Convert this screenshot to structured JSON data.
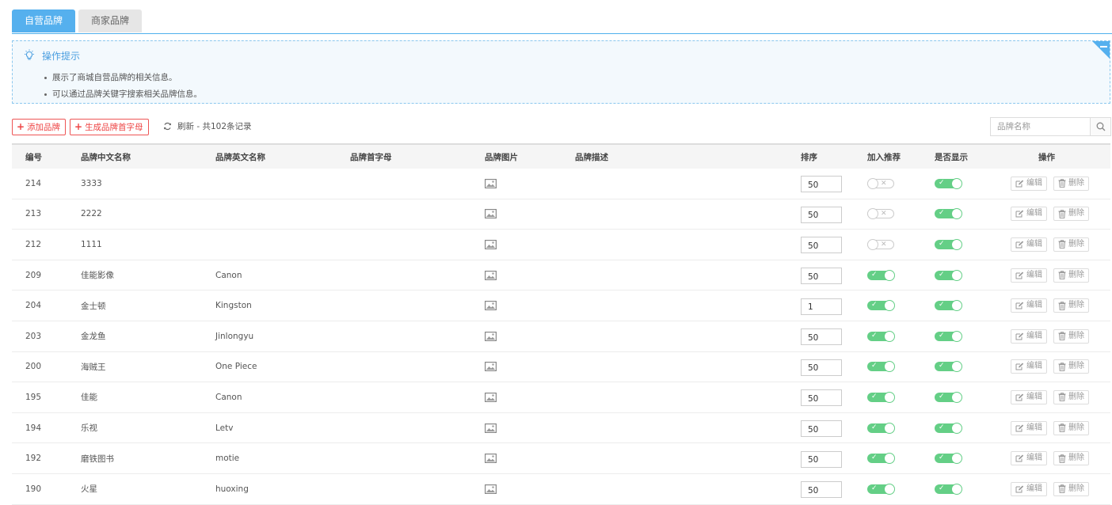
{
  "tabs": [
    {
      "label": "自营品牌",
      "active": true
    },
    {
      "label": "商家品牌",
      "active": false
    }
  ],
  "tips": {
    "title": "操作提示",
    "items": [
      "展示了商城自营品牌的相关信息。",
      "可以通过品牌关键字搜索相关品牌信息。"
    ]
  },
  "toolbar": {
    "add_label": "添加品牌",
    "generate_label": "生成品牌首字母",
    "refresh_label": "刷新 - 共102条记录",
    "search_placeholder": "品牌名称"
  },
  "table": {
    "headers": {
      "id": "编号",
      "cn_name": "品牌中文名称",
      "en_name": "品牌英文名称",
      "letter": "品牌首字母",
      "image": "品牌图片",
      "desc": "品牌描述",
      "sort": "排序",
      "recommend": "加入推荐",
      "show": "是否显示",
      "ops": "操作"
    },
    "edit_label": "编辑",
    "delete_label": "删除",
    "rows": [
      {
        "id": "214",
        "cn": "3333",
        "en": "",
        "sort": "50",
        "recommend": false,
        "show": true
      },
      {
        "id": "213",
        "cn": "2222",
        "en": "",
        "sort": "50",
        "recommend": false,
        "show": true
      },
      {
        "id": "212",
        "cn": "1111",
        "en": "",
        "sort": "50",
        "recommend": false,
        "show": true
      },
      {
        "id": "209",
        "cn": "佳能影像",
        "en": "Canon",
        "sort": "50",
        "recommend": true,
        "show": true
      },
      {
        "id": "204",
        "cn": "金士顿",
        "en": "Kingston",
        "sort": "1",
        "recommend": true,
        "show": true
      },
      {
        "id": "203",
        "cn": "金龙鱼",
        "en": "Jinlongyu",
        "sort": "50",
        "recommend": true,
        "show": true
      },
      {
        "id": "200",
        "cn": "海贼王",
        "en": "One Piece",
        "sort": "50",
        "recommend": true,
        "show": true
      },
      {
        "id": "195",
        "cn": "佳能",
        "en": "Canon",
        "sort": "50",
        "recommend": true,
        "show": true
      },
      {
        "id": "194",
        "cn": "乐视",
        "en": "Letv",
        "sort": "50",
        "recommend": true,
        "show": true
      },
      {
        "id": "192",
        "cn": "磨铁图书",
        "en": "motie",
        "sort": "50",
        "recommend": true,
        "show": true
      },
      {
        "id": "190",
        "cn": "火星",
        "en": "huoxing",
        "sort": "50",
        "recommend": true,
        "show": true
      }
    ]
  },
  "colors": {
    "accent": "#55b0ee",
    "danger": "#e55555",
    "switch_on": "#64cf86"
  },
  "icons": {
    "tips": "lightbulb-icon",
    "refresh": "refresh-icon",
    "search": "search-icon",
    "image": "image-icon",
    "edit": "edit-icon",
    "delete": "trash-icon",
    "collapse": "collapse-icon"
  }
}
